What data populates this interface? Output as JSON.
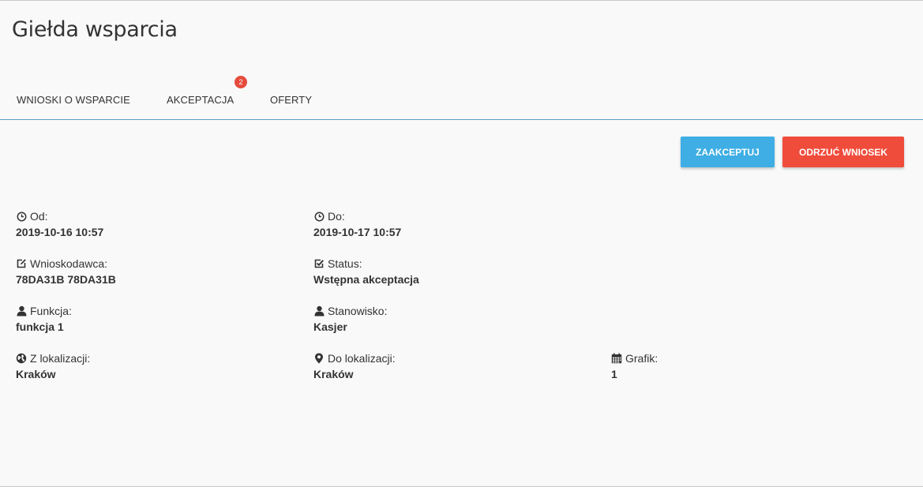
{
  "page": {
    "title": "Giełda wsparcia"
  },
  "tabs": [
    {
      "label": "WNIOSKI O WSPARCIE"
    },
    {
      "label": "AKCEPTACJA",
      "badge": "2"
    },
    {
      "label": "OFERTY"
    }
  ],
  "actions": {
    "accept_label": "ZAAKCEPTUJ",
    "reject_label": "ODRZUĆ WNIOSEK"
  },
  "colors": {
    "accent": "#3eaee4",
    "danger": "#f04c3b",
    "badge": "#e54b3c",
    "tab_underline": "#5c9fc8"
  },
  "details": {
    "from": {
      "label": "Od:",
      "value": "2019-10-16 10:57",
      "icon": "clock-icon"
    },
    "to": {
      "label": "Do:",
      "value": "2019-10-17 10:57",
      "icon": "clock-icon"
    },
    "applicant": {
      "label": "Wnioskodawca:",
      "value": "78DA31B 78DA31B",
      "icon": "edit-icon"
    },
    "status": {
      "label": "Status:",
      "value": "Wstępna akceptacja",
      "icon": "check-square-icon"
    },
    "function": {
      "label": "Funkcja:",
      "value": "funkcja 1",
      "icon": "user-icon"
    },
    "position": {
      "label": "Stanowisko:",
      "value": "Kasjer",
      "icon": "user-icon"
    },
    "from_location": {
      "label": "Z lokalizacji:",
      "value": "Kraków",
      "icon": "globe-icon"
    },
    "to_location": {
      "label": "Do lokalizacji:",
      "value": "Kraków",
      "icon": "map-marker-icon"
    },
    "schedule": {
      "label": "Grafik:",
      "value": "1",
      "icon": "calendar-icon"
    }
  }
}
